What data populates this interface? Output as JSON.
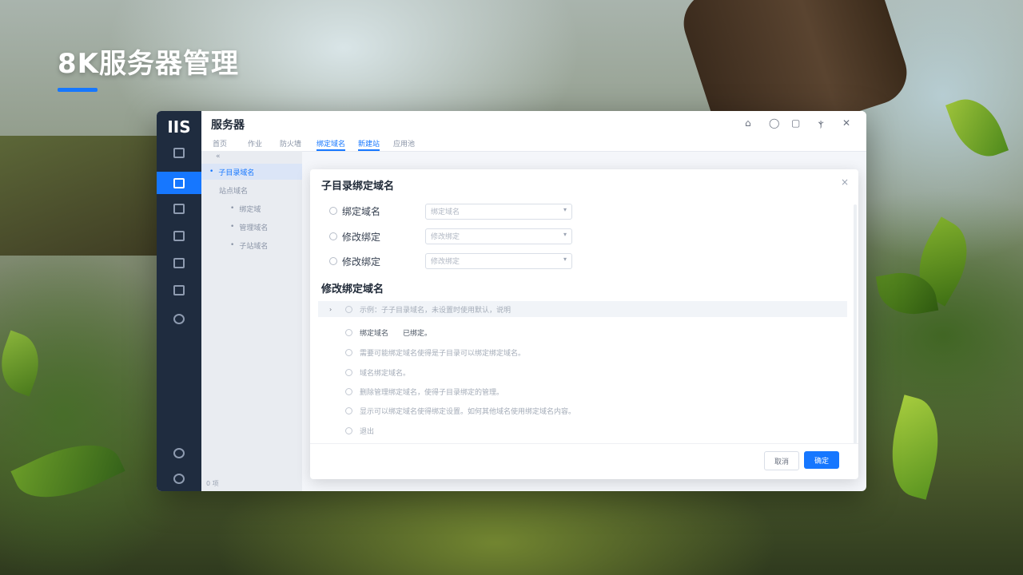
{
  "slide": {
    "title": "8K服务器管理",
    "accent_color": "#1677ff"
  },
  "window": {
    "logo": "IIS",
    "title": "服务器",
    "controls": [
      "⌂",
      "◯",
      "▢",
      "ⲯ",
      "✕"
    ],
    "tabs": [
      {
        "label": "首页",
        "active": false
      },
      {
        "label": "作业",
        "active": false
      },
      {
        "label": "防火墙",
        "active": false
      },
      {
        "label": "绑定域名",
        "active": true
      },
      {
        "label": "新建站",
        "active": true
      },
      {
        "label": "应用池",
        "active": false
      }
    ],
    "rail_icons": [
      "home-icon",
      "server-icon",
      "grid-icon",
      "list-icon",
      "chart-icon",
      "house-icon",
      "globe-icon",
      "clock-icon",
      "power-icon"
    ],
    "subnav": {
      "back": "«",
      "items": [
        {
          "label": "子目录域名",
          "selected": true
        },
        {
          "label": "站点域名",
          "selected": false
        },
        {
          "label": "绑定域",
          "selected": false
        },
        {
          "label": "管理域名",
          "selected": false
        },
        {
          "label": "子站域名",
          "selected": false
        }
      ],
      "status": "0 项"
    }
  },
  "modal": {
    "title": "子目录绑定域名",
    "close": "×",
    "form": [
      {
        "label": "绑定域名",
        "placeholder": "绑定域名"
      },
      {
        "label": "修改绑定",
        "placeholder": "修改绑定"
      },
      {
        "label": "修改绑定",
        "placeholder": "修改绑定"
      }
    ],
    "section_title": "修改绑定域名",
    "options": [
      {
        "text": "示例：子子目录域名，未设置时使用默认，说明",
        "highlighted": true,
        "caret": "›"
      },
      {
        "text": "绑定域名　　已绑定。",
        "highlighted": false,
        "caret": ""
      },
      {
        "text": "需要可能绑定域名使得是子目录可以绑定绑定域名。",
        "highlighted": false,
        "caret": ""
      },
      {
        "text": "域名绑定域名。",
        "highlighted": false,
        "caret": ""
      },
      {
        "text": "删除管理绑定域名，使得子目录绑定的管理。",
        "highlighted": false,
        "caret": ""
      },
      {
        "text": "显示可以绑定域名使得绑定设置。如何其他域名使用绑定域名内容。",
        "highlighted": false,
        "caret": ""
      },
      {
        "text": "退出",
        "highlighted": false,
        "caret": ""
      }
    ],
    "cancel_label": "取消",
    "ok_label": "确定"
  }
}
